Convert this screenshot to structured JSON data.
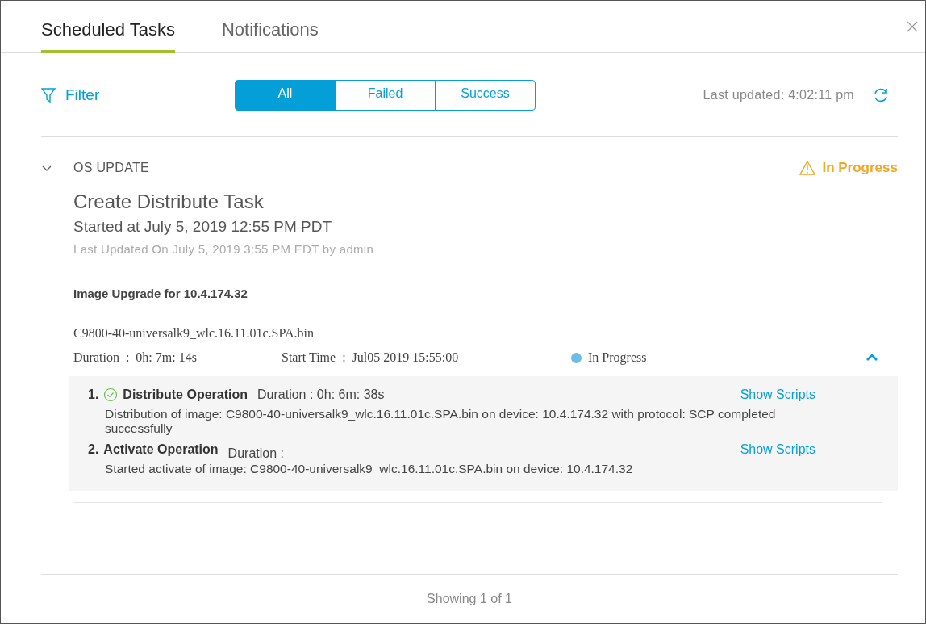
{
  "tabs": [
    {
      "label": "Scheduled Tasks",
      "selected": true
    },
    {
      "label": "Notifications",
      "selected": false
    }
  ],
  "filter": {
    "label": "Filter"
  },
  "segments": [
    {
      "label": "All",
      "selected": true
    },
    {
      "label": "Failed",
      "selected": false
    },
    {
      "label": "Success",
      "selected": false
    }
  ],
  "last_updated": "Last updated: 4:02:11 pm",
  "task": {
    "category": "OS UPDATE",
    "expanded": true,
    "status": "In Progress",
    "title": "Create Distribute Task",
    "started": "Started at July 5, 2019 12:55 PM PDT",
    "updated": "Last Updated On July 5, 2019 3:55 PM EDT by admin",
    "heading": "Image Upgrade for 10.4.174.32",
    "image": {
      "file": "C9800-40-universalk9_wlc.16.11.01c.SPA.bin",
      "duration": "Duration  :  0h: 7m: 14s",
      "start_time": "Start Time  :  Jul05 2019 15:55:00",
      "status": "In Progress",
      "color": "#6bbde3",
      "expanded": true
    },
    "operations": [
      {
        "number": "1.",
        "name": "Distribute Operation",
        "completed": true,
        "duration": "Duration : 0h: 6m: 38s",
        "link": "Show Scripts",
        "message": "Distribution of image: C9800-40-universalk9_wlc.16.11.01c.SPA.bin on device: 10.4.174.32 with protocol: SCP completed successfully"
      },
      {
        "number": "2.",
        "name": "Activate Operation",
        "completed": false,
        "duration": "Duration :",
        "link": "Show Scripts",
        "message": "Started activate of image: C9800-40-universalk9_wlc.16.11.01c.SPA.bin on device: 10.4.174.32"
      }
    ]
  },
  "footer": "Showing 1 of 1"
}
